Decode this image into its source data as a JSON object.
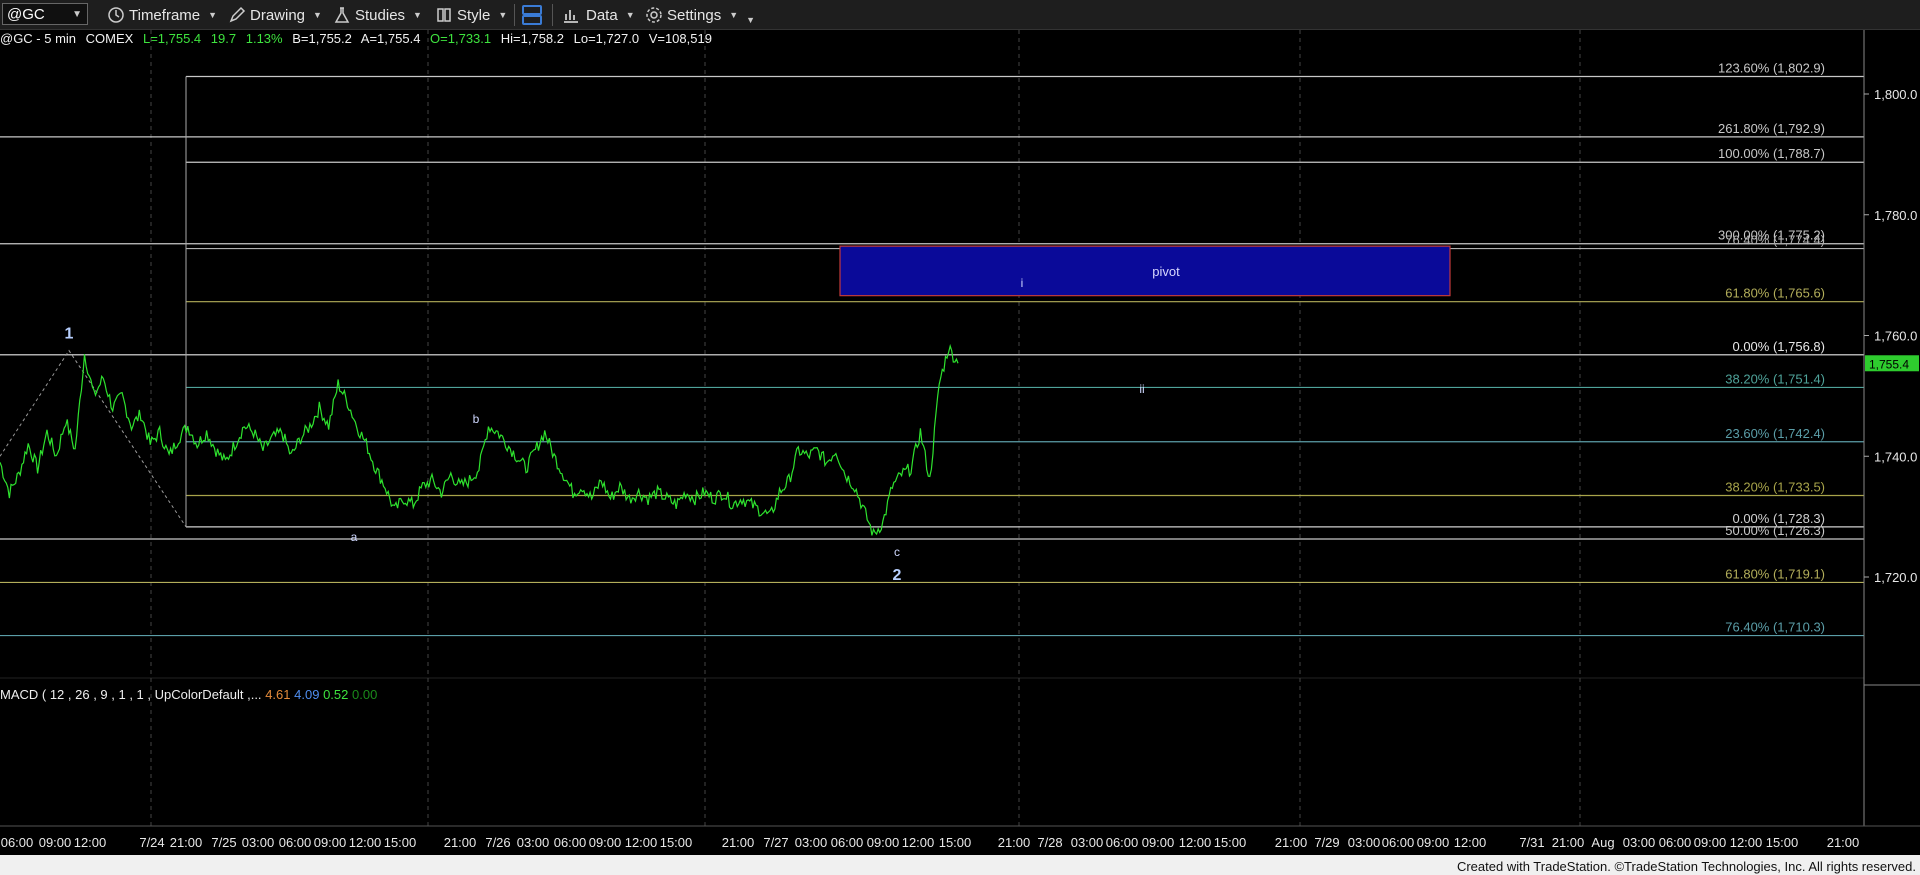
{
  "toolbar": {
    "symbol": "@GC",
    "timeframe": "Timeframe",
    "drawing": "Drawing",
    "studies": "Studies",
    "style": "Style",
    "data": "Data",
    "settings": "Settings"
  },
  "info": {
    "symbol_tf": "@GC - 5 min",
    "exchange": "COMEX",
    "last": "L=1,755.4",
    "change": "19.7",
    "change_pct": "1.13%",
    "bid": "B=1,755.2",
    "ask": "A=1,755.4",
    "open": "O=1,733.1",
    "high": "Hi=1,758.2",
    "low": "Lo=1,727.0",
    "volume": "V=108,519"
  },
  "chart_data": {
    "type": "line",
    "title": "@GC - 5 min",
    "ylim": [
      1700,
      1812
    ],
    "y_ticks": [
      "1,800.0",
      "1,780.0",
      "1,760.0",
      "1,740.0",
      "1,720.0"
    ],
    "y_tick_values": [
      1800,
      1780,
      1760,
      1740,
      1720
    ],
    "last_price_label": "1,755.4",
    "x_ticks": [
      "06:00",
      "09:00",
      "12:00",
      "7/24",
      "21:00",
      "7/25",
      "03:00",
      "06:00",
      "09:00",
      "12:00",
      "15:00",
      "21:00",
      "7/26",
      "03:00",
      "06:00",
      "09:00",
      "12:00",
      "15:00",
      "21:00",
      "7/27",
      "03:00",
      "06:00",
      "09:00",
      "12:00",
      "15:00",
      "21:00",
      "7/28",
      "03:00",
      "06:00",
      "09:00",
      "12:00",
      "15:00",
      "21:00",
      "7/29",
      "03:00",
      "06:00",
      "09:00",
      "12:00",
      "7/31",
      "21:00",
      "Aug",
      "03:00",
      "06:00",
      "09:00",
      "12:00",
      "15:00",
      "21:00"
    ],
    "fib_levels": [
      {
        "label": "123.60% (1,802.9)",
        "value": 1802.9,
        "color": "#c8c8c8"
      },
      {
        "label": "261.80% (1,792.9)",
        "value": 1792.9,
        "color": "#c8c8c8"
      },
      {
        "label": "100.00% (1,788.7)",
        "value": 1788.7,
        "color": "#c8c8c8"
      },
      {
        "label": "300.00% (1,775.2)",
        "value": 1775.2,
        "color": "#c8c8c8"
      },
      {
        "label": "76.40% (1,774.4)",
        "value": 1774.4,
        "color": "#b0b0b0"
      },
      {
        "label": "61.80% (1,765.6)",
        "value": 1765.6,
        "color": "#b3ae5a"
      },
      {
        "label": "0.00% (1,756.8)",
        "value": 1756.8,
        "color": "#e8e8e8"
      },
      {
        "label": "38.20% (1,751.4)",
        "value": 1751.4,
        "color": "#4fa39a"
      },
      {
        "label": "23.60% (1,742.4)",
        "value": 1742.4,
        "color": "#5b9ea8"
      },
      {
        "label": "38.20% (1,733.5)",
        "value": 1733.5,
        "color": "#a8a44a"
      },
      {
        "label": "0.00% (1,728.3)",
        "value": 1728.3,
        "color": "#d0d0d0"
      },
      {
        "label": "50.00% (1,726.3)",
        "value": 1726.3,
        "color": "#c8c8c8"
      },
      {
        "label": "61.80% (1,719.1)",
        "value": 1719.1,
        "color": "#b3ae5a"
      },
      {
        "label": "76.40% (1,710.3)",
        "value": 1710.3,
        "color": "#5b9ea8"
      }
    ],
    "pivot_zone": {
      "label": "pivot",
      "top": 1774.8,
      "bottom": 1766.6
    },
    "wave_labels": [
      {
        "text": "1",
        "price": 1759.5
      },
      {
        "text": "a",
        "price": 1726.0
      },
      {
        "text": "b",
        "price": 1745.5
      },
      {
        "text": "c",
        "price": 1723.5
      },
      {
        "text": "2",
        "price": 1719.5
      },
      {
        "text": "i",
        "price": 1768.0
      },
      {
        "text": "ii",
        "price": 1750.5
      }
    ],
    "series": [
      {
        "values": [
          1739,
          1734,
          1737,
          1742,
          1738,
          1744,
          1740,
          1746,
          1741,
          1757,
          1750,
          1753,
          1748,
          1750,
          1745,
          1747,
          1742,
          1744,
          1740,
          1743,
          1745,
          1742,
          1744,
          1741,
          1739,
          1742,
          1745,
          1744,
          1741,
          1743,
          1744,
          1740,
          1743,
          1745,
          1748,
          1745,
          1752,
          1749,
          1745,
          1742,
          1738,
          1735,
          1731,
          1733,
          1732,
          1735,
          1736,
          1734,
          1737,
          1735,
          1736,
          1738,
          1745,
          1744,
          1742,
          1740,
          1738,
          1741,
          1744,
          1740,
          1737,
          1734,
          1735,
          1733,
          1736,
          1733,
          1735,
          1733,
          1734,
          1733,
          1734,
          1733,
          1732,
          1734,
          1733,
          1734,
          1733,
          1734,
          1732,
          1733,
          1732,
          1731,
          1730,
          1734,
          1736,
          1741,
          1740,
          1741,
          1739,
          1741,
          1737,
          1735,
          1731,
          1727,
          1729,
          1735,
          1737,
          1738,
          1744,
          1736,
          1752,
          1758,
          1755.4
        ]
      }
    ],
    "macd": {
      "label": "MACD ( 12 , 26 , 9 , 1 , 1 , UpColorDefault ,...",
      "v1": "4.61",
      "v2": "4.09",
      "v3": "0.52",
      "v4": "0.00"
    }
  },
  "credit": "Created with TradeStation. ©TradeStation Technologies, Inc. All rights reserved."
}
